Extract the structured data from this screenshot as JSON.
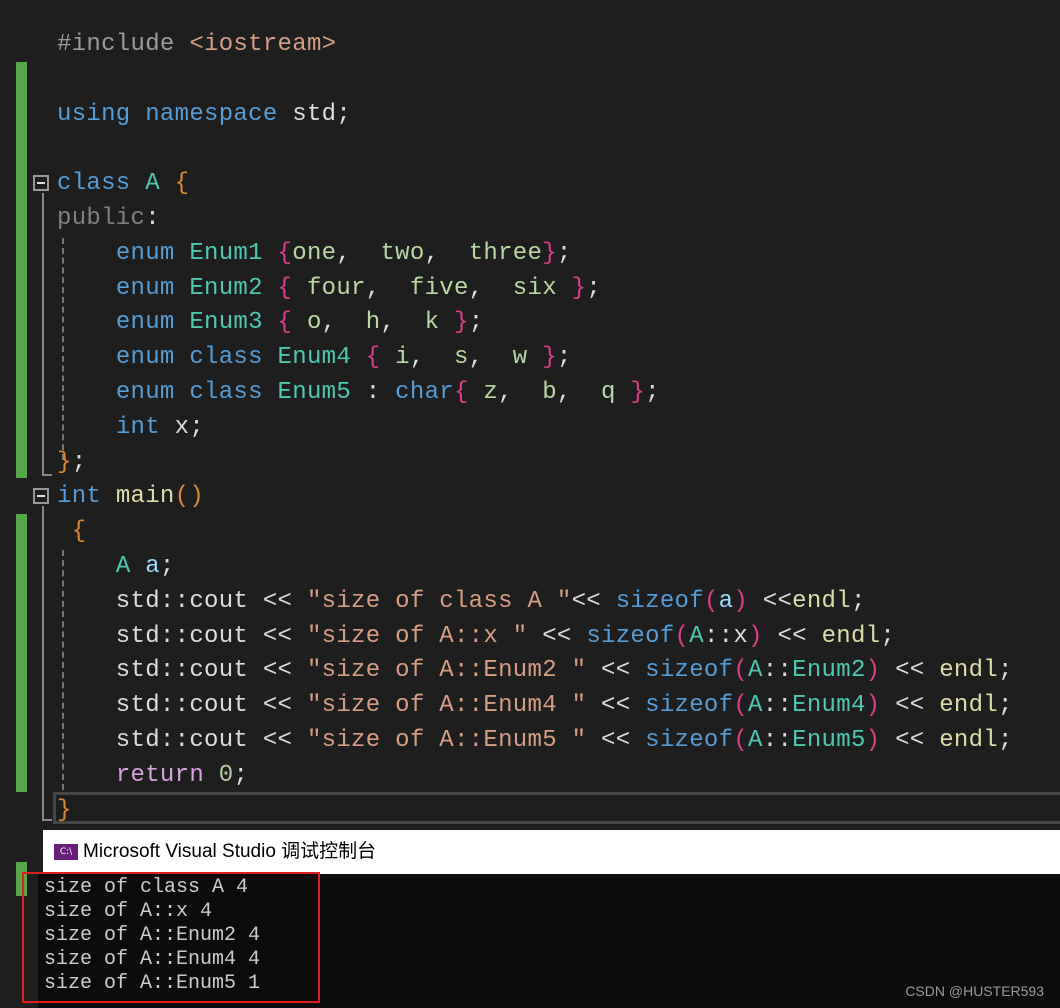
{
  "editor": {
    "lines": [
      {
        "id": "include",
        "tokens": [
          [
            "pp",
            "#include "
          ],
          [
            "inc",
            "<iostream>"
          ]
        ]
      },
      {
        "id": "blank1",
        "tokens": []
      },
      {
        "id": "using",
        "tokens": [
          [
            "kw",
            "using"
          ],
          [
            "plain",
            " "
          ],
          [
            "kw",
            "namespace"
          ],
          [
            "plain",
            " std;"
          ]
        ]
      },
      {
        "id": "blank2",
        "tokens": []
      },
      {
        "id": "class-decl",
        "tokens": [
          [
            "kw",
            "class"
          ],
          [
            "plain",
            " "
          ],
          [
            "ty",
            "A"
          ],
          [
            "plain",
            " "
          ],
          [
            "br-o",
            "{"
          ]
        ]
      },
      {
        "id": "public",
        "tokens": [
          [
            "acc",
            "public"
          ],
          [
            "plain",
            ":"
          ]
        ]
      },
      {
        "id": "enum1",
        "tokens": [
          [
            "plain",
            "    "
          ],
          [
            "kw",
            "enum"
          ],
          [
            "plain",
            " "
          ],
          [
            "ty",
            "Enum1"
          ],
          [
            "plain",
            " "
          ],
          [
            "br-p",
            "{"
          ],
          [
            "en",
            "one"
          ],
          [
            "plain",
            ",  "
          ],
          [
            "en",
            "two"
          ],
          [
            "plain",
            ",  "
          ],
          [
            "en",
            "three"
          ],
          [
            "br-p",
            "}"
          ],
          [
            "plain",
            ";"
          ]
        ]
      },
      {
        "id": "enum2",
        "tokens": [
          [
            "plain",
            "    "
          ],
          [
            "kw",
            "enum"
          ],
          [
            "plain",
            " "
          ],
          [
            "ty",
            "Enum2"
          ],
          [
            "plain",
            " "
          ],
          [
            "br-p",
            "{"
          ],
          [
            "plain",
            " "
          ],
          [
            "en",
            "four"
          ],
          [
            "plain",
            ",  "
          ],
          [
            "en",
            "five"
          ],
          [
            "plain",
            ",  "
          ],
          [
            "en",
            "six"
          ],
          [
            "plain",
            " "
          ],
          [
            "br-p",
            "}"
          ],
          [
            "plain",
            ";"
          ]
        ]
      },
      {
        "id": "enum3",
        "tokens": [
          [
            "plain",
            "    "
          ],
          [
            "kw",
            "enum"
          ],
          [
            "plain",
            " "
          ],
          [
            "ty",
            "Enum3"
          ],
          [
            "plain",
            " "
          ],
          [
            "br-p",
            "{"
          ],
          [
            "plain",
            " "
          ],
          [
            "en",
            "o"
          ],
          [
            "plain",
            ",  "
          ],
          [
            "en",
            "h"
          ],
          [
            "plain",
            ",  "
          ],
          [
            "en",
            "k"
          ],
          [
            "plain",
            " "
          ],
          [
            "br-p",
            "}"
          ],
          [
            "plain",
            ";"
          ]
        ]
      },
      {
        "id": "enum4",
        "tokens": [
          [
            "plain",
            "    "
          ],
          [
            "kw",
            "enum"
          ],
          [
            "plain",
            " "
          ],
          [
            "kw",
            "class"
          ],
          [
            "plain",
            " "
          ],
          [
            "ty",
            "Enum4"
          ],
          [
            "plain",
            " "
          ],
          [
            "br-p",
            "{"
          ],
          [
            "plain",
            " "
          ],
          [
            "en",
            "i"
          ],
          [
            "plain",
            ",  "
          ],
          [
            "en",
            "s"
          ],
          [
            "plain",
            ",  "
          ],
          [
            "en",
            "w"
          ],
          [
            "plain",
            " "
          ],
          [
            "br-p",
            "}"
          ],
          [
            "plain",
            ";"
          ]
        ]
      },
      {
        "id": "enum5",
        "tokens": [
          [
            "plain",
            "    "
          ],
          [
            "kw",
            "enum"
          ],
          [
            "plain",
            " "
          ],
          [
            "kw",
            "class"
          ],
          [
            "plain",
            " "
          ],
          [
            "ty",
            "Enum5"
          ],
          [
            "plain",
            " : "
          ],
          [
            "kw",
            "char"
          ],
          [
            "br-p",
            "{"
          ],
          [
            "plain",
            " "
          ],
          [
            "en",
            "z"
          ],
          [
            "plain",
            ",  "
          ],
          [
            "en",
            "b"
          ],
          [
            "plain",
            ",  "
          ],
          [
            "en",
            "q"
          ],
          [
            "plain",
            " "
          ],
          [
            "br-p",
            "}"
          ],
          [
            "plain",
            ";"
          ]
        ]
      },
      {
        "id": "int-x",
        "tokens": [
          [
            "plain",
            "    "
          ],
          [
            "kw",
            "int"
          ],
          [
            "plain",
            " x;"
          ]
        ]
      },
      {
        "id": "class-close",
        "tokens": [
          [
            "br-o",
            "}"
          ],
          [
            "plain",
            ";"
          ]
        ]
      },
      {
        "id": "main-decl",
        "tokens": [
          [
            "kw",
            "int"
          ],
          [
            "plain",
            " "
          ],
          [
            "fn",
            "main"
          ],
          [
            "br-o",
            "()"
          ]
        ]
      },
      {
        "id": "main-open",
        "tokens": [
          [
            "br-o",
            " {"
          ]
        ]
      },
      {
        "id": "a-decl",
        "tokens": [
          [
            "plain",
            "    "
          ],
          [
            "ty",
            "A"
          ],
          [
            "plain",
            " "
          ],
          [
            "var",
            "a"
          ],
          [
            "plain",
            ";"
          ]
        ]
      },
      {
        "id": "cout1",
        "tokens": [
          [
            "plain",
            "    std::cout << "
          ],
          [
            "str",
            "\"size of class A \""
          ],
          [
            "plain",
            "<< "
          ],
          [
            "kw",
            "sizeof"
          ],
          [
            "br-p",
            "("
          ],
          [
            "var",
            "a"
          ],
          [
            "br-p",
            ")"
          ],
          [
            "plain",
            " <<"
          ],
          [
            "fn",
            "endl"
          ],
          [
            "plain",
            ";"
          ]
        ]
      },
      {
        "id": "cout2",
        "tokens": [
          [
            "plain",
            "    std::cout << "
          ],
          [
            "str",
            "\"size of A::x \""
          ],
          [
            "plain",
            " << "
          ],
          [
            "kw",
            "sizeof"
          ],
          [
            "br-p",
            "("
          ],
          [
            "ty",
            "A"
          ],
          [
            "plain",
            "::x"
          ],
          [
            "br-p",
            ")"
          ],
          [
            "plain",
            " << "
          ],
          [
            "fn",
            "endl"
          ],
          [
            "plain",
            ";"
          ]
        ]
      },
      {
        "id": "cout3",
        "tokens": [
          [
            "plain",
            "    std::cout << "
          ],
          [
            "str",
            "\"size of A::Enum2 \""
          ],
          [
            "plain",
            " << "
          ],
          [
            "kw",
            "sizeof"
          ],
          [
            "br-p",
            "("
          ],
          [
            "ty",
            "A"
          ],
          [
            "plain",
            "::"
          ],
          [
            "ty",
            "Enum2"
          ],
          [
            "br-p",
            ")"
          ],
          [
            "plain",
            " << "
          ],
          [
            "fn",
            "endl"
          ],
          [
            "plain",
            ";"
          ]
        ]
      },
      {
        "id": "cout4",
        "tokens": [
          [
            "plain",
            "    std::cout << "
          ],
          [
            "str",
            "\"size of A::Enum4 \""
          ],
          [
            "plain",
            " << "
          ],
          [
            "kw",
            "sizeof"
          ],
          [
            "br-p",
            "("
          ],
          [
            "ty",
            "A"
          ],
          [
            "plain",
            "::"
          ],
          [
            "ty",
            "Enum4"
          ],
          [
            "br-p",
            ")"
          ],
          [
            "plain",
            " << "
          ],
          [
            "fn",
            "endl"
          ],
          [
            "plain",
            ";"
          ]
        ]
      },
      {
        "id": "cout5",
        "tokens": [
          [
            "plain",
            "    std::cout << "
          ],
          [
            "str",
            "\"size of A::Enum5 \""
          ],
          [
            "plain",
            " << "
          ],
          [
            "kw",
            "sizeof"
          ],
          [
            "br-p",
            "("
          ],
          [
            "ty",
            "A"
          ],
          [
            "plain",
            "::"
          ],
          [
            "ty",
            "Enum5"
          ],
          [
            "br-p",
            ")"
          ],
          [
            "plain",
            " << "
          ],
          [
            "fn",
            "endl"
          ],
          [
            "plain",
            ";"
          ]
        ]
      },
      {
        "id": "return",
        "tokens": [
          [
            "plain",
            "    "
          ],
          [
            "ret",
            "return"
          ],
          [
            "plain",
            " "
          ],
          [
            "num",
            "0"
          ],
          [
            "plain",
            ";"
          ]
        ]
      },
      {
        "id": "main-close",
        "tokens": [
          [
            "br-o",
            "}"
          ]
        ]
      }
    ]
  },
  "console": {
    "title": "Microsoft Visual Studio 调试控制台",
    "icon_label": "C:\\",
    "output": [
      "size of class A 4",
      "size of A::x 4",
      "size of A::Enum2 4",
      "size of A::Enum4 4",
      "size of A::Enum5 1"
    ]
  },
  "watermark": "CSDN @HUSTER593",
  "colors": {
    "keyword": "#569cd6",
    "type": "#4ec9b0",
    "string": "#d69d85",
    "change_bar": "#57a64a",
    "highlight_box": "#e02020"
  }
}
